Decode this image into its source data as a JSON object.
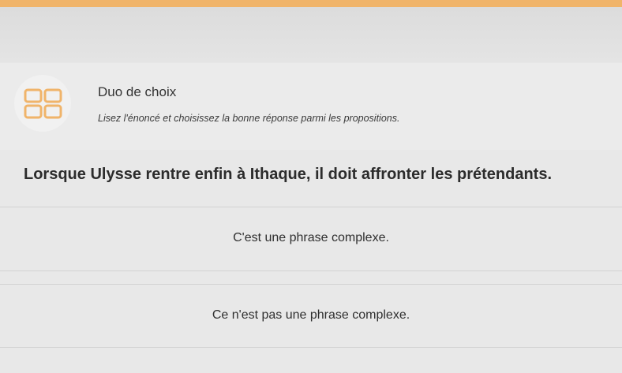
{
  "activity": {
    "title": "Duo de choix",
    "instructions": "Lisez l'énoncé et choisissez la bonne réponse parmi les propositions.",
    "icon": "grid-icon"
  },
  "question": {
    "text": "Lorsque Ulysse rentre enfin à Ithaque, il doit affronter les prétendants."
  },
  "options": [
    {
      "label": "C'est une phrase complexe."
    },
    {
      "label": "Ce n'est pas une phrase complexe."
    }
  ],
  "colors": {
    "accent": "#f0b46a",
    "icon": "#f0b46a",
    "background": "#e6e6e6"
  }
}
